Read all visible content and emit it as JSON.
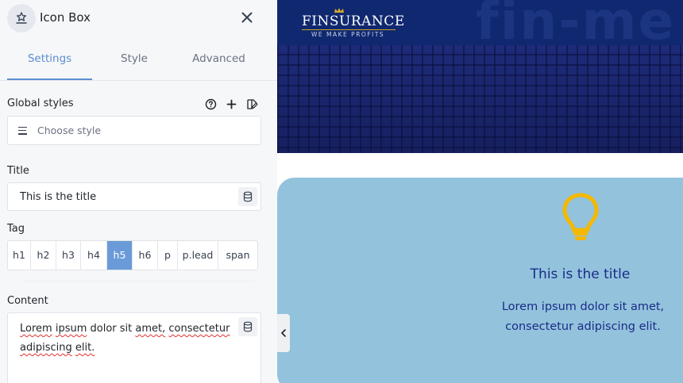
{
  "panel": {
    "title": "Icon Box",
    "tabs": [
      {
        "label": "Settings",
        "active": true
      },
      {
        "label": "Style",
        "active": false
      },
      {
        "label": "Advanced",
        "active": false
      }
    ],
    "global_styles": {
      "label": "Global styles",
      "placeholder": "Choose style"
    },
    "title_field": {
      "label": "Title",
      "value": "This is the title"
    },
    "tag_field": {
      "label": "Tag",
      "options": [
        "h1",
        "h2",
        "h3",
        "h4",
        "h5",
        "h6",
        "p",
        "p.lead",
        "span"
      ],
      "selected": "h5"
    },
    "content_field": {
      "label": "Content",
      "words": [
        "Lorem",
        "ipsum",
        "dolor sit",
        "amet,",
        "consectetur",
        "adipiscing",
        "elit."
      ]
    },
    "accent": "#5b8ed1"
  },
  "preview": {
    "site": {
      "logo_name": "FINSURANCE",
      "logo_tagline": "WE MAKE PROFITS",
      "bg_word": "fin-me"
    },
    "icon_box": {
      "icon": "lightbulb-icon",
      "title": "This is the title",
      "text": "Lorem ipsum dolor sit amet, consectetur adipiscing elit."
    },
    "colors": {
      "card_bg": "#93c3dc",
      "title": "#1a2b88",
      "icon": "#f5b800"
    }
  }
}
